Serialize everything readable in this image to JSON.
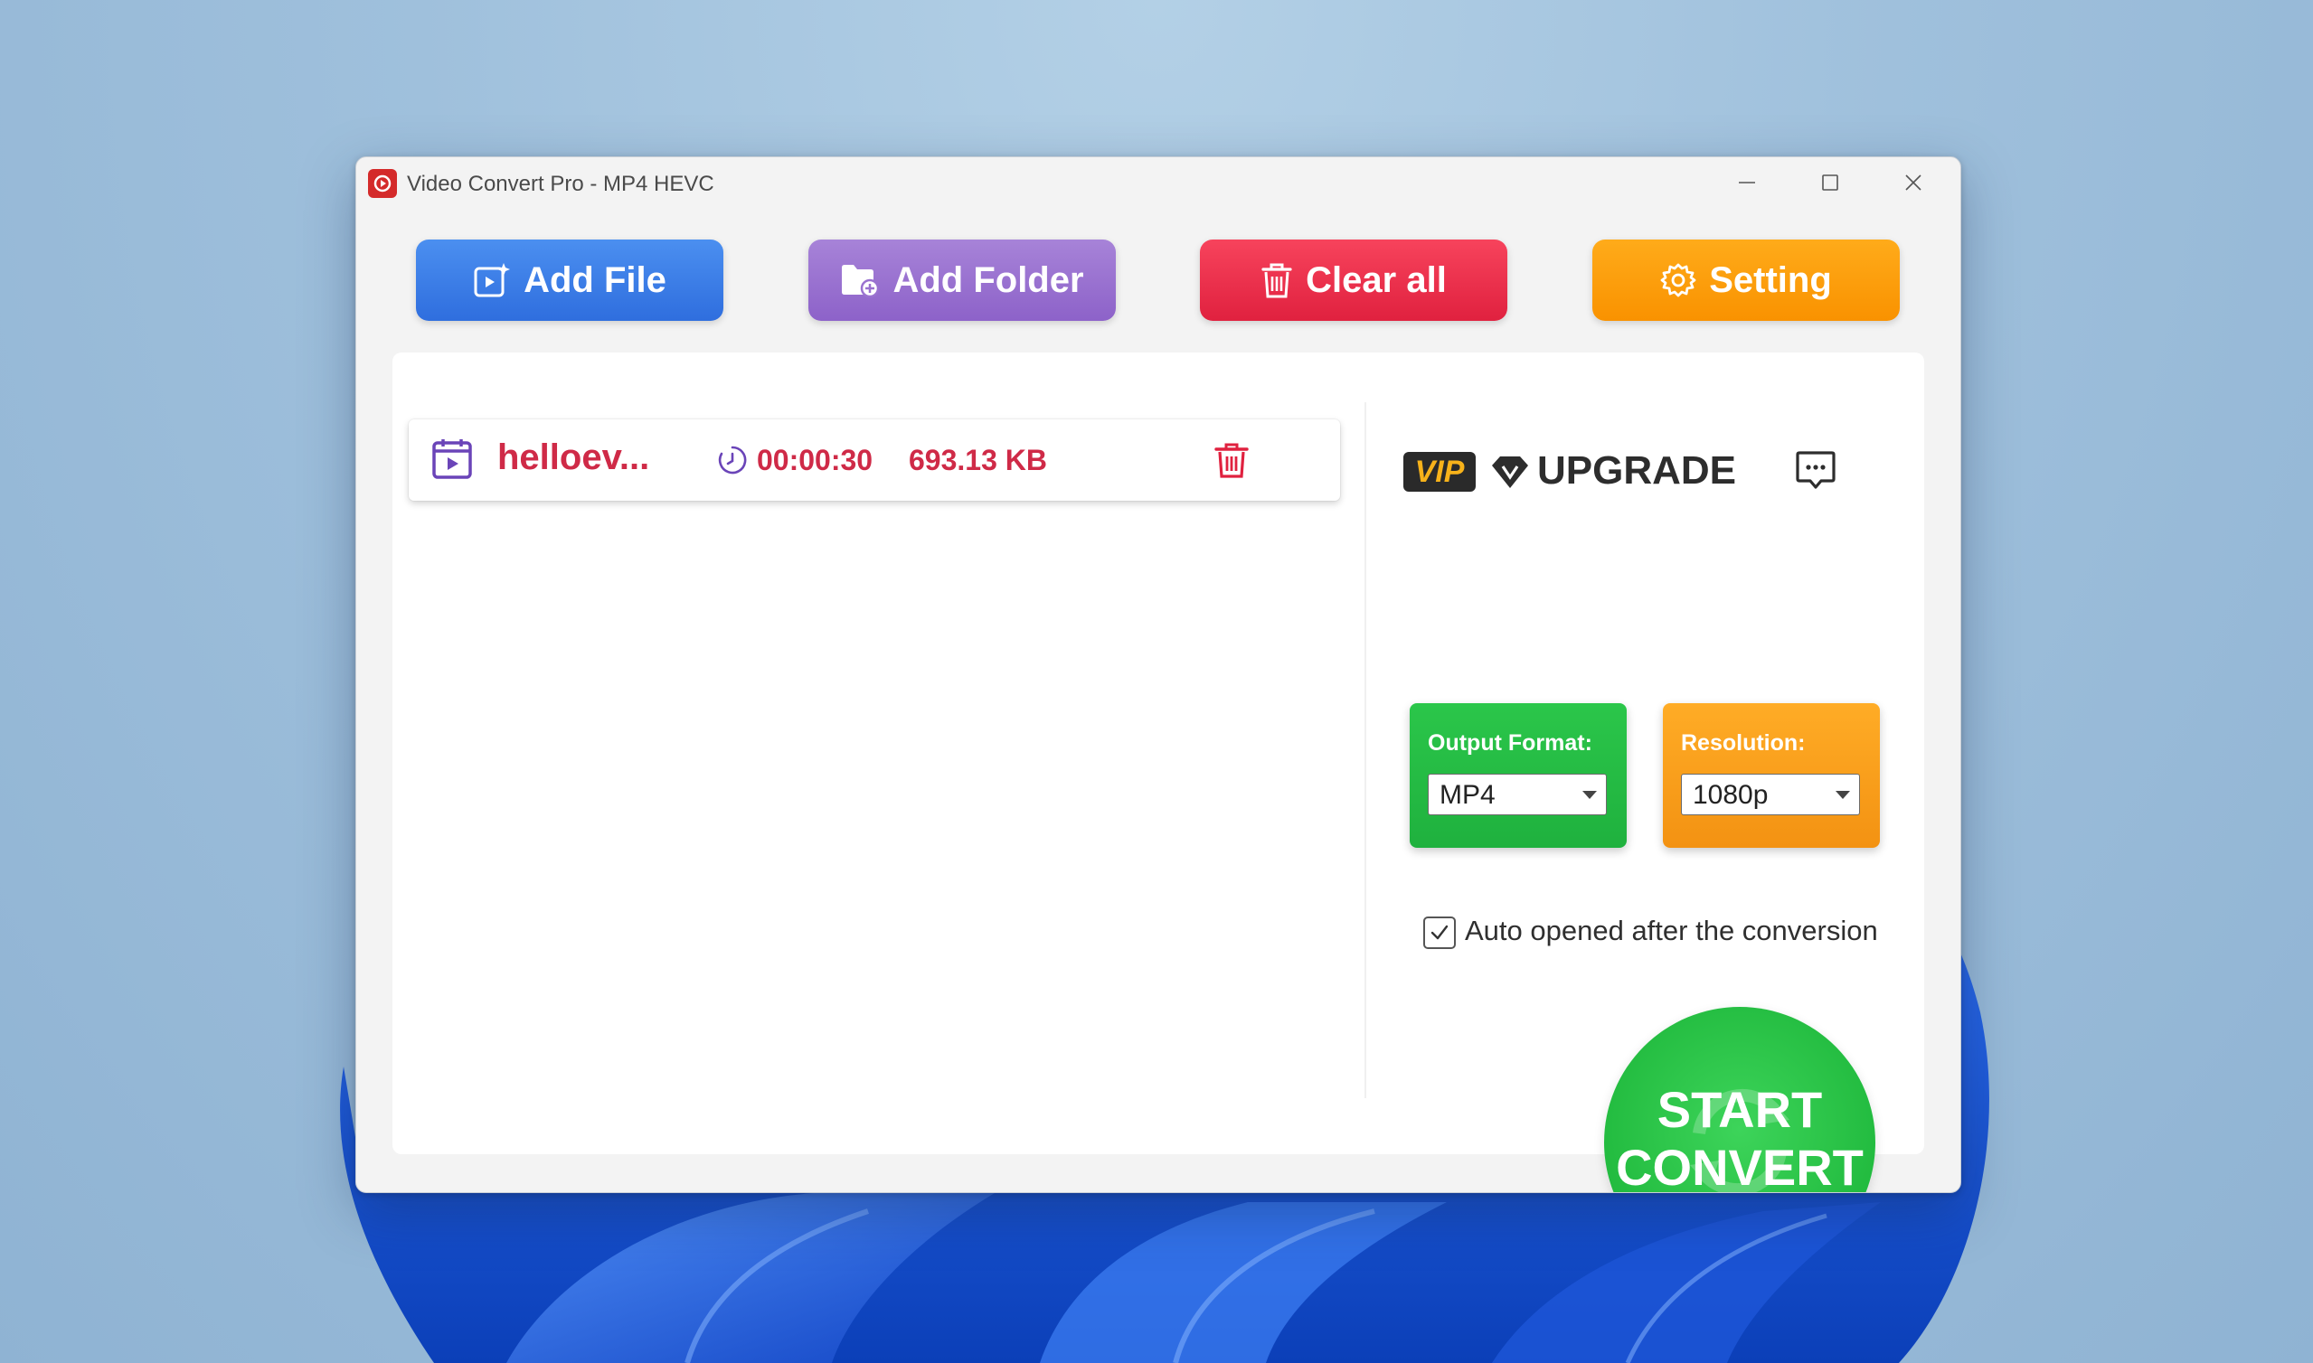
{
  "window": {
    "title": "Video Convert Pro - MP4 HEVC"
  },
  "toolbar": {
    "add_file": "Add File",
    "add_folder": "Add Folder",
    "clear_all": "Clear all",
    "setting": "Setting"
  },
  "files": [
    {
      "name": "helloev...",
      "duration": "00:00:30",
      "size": "693.13 KB"
    }
  ],
  "upgrade": {
    "vip": "VIP",
    "label": "UPGRADE"
  },
  "output_format": {
    "label": "Output Format:",
    "value": "MP4"
  },
  "resolution": {
    "label": "Resolution:",
    "value": "1080p"
  },
  "auto_open": {
    "label": "Auto opened after the conversion",
    "checked": true
  },
  "start": {
    "line1": "START",
    "line2": "CONVERT"
  },
  "colors": {
    "add_file": "#3a7ee6",
    "add_folder": "#9a72d0",
    "clear_all": "#ec2f4c",
    "setting": "#fd9d0d",
    "file_text": "#cf2a47",
    "format_card": "#25bd44",
    "resolution_card": "#f99e1c",
    "start_button": "#22bb3f"
  }
}
